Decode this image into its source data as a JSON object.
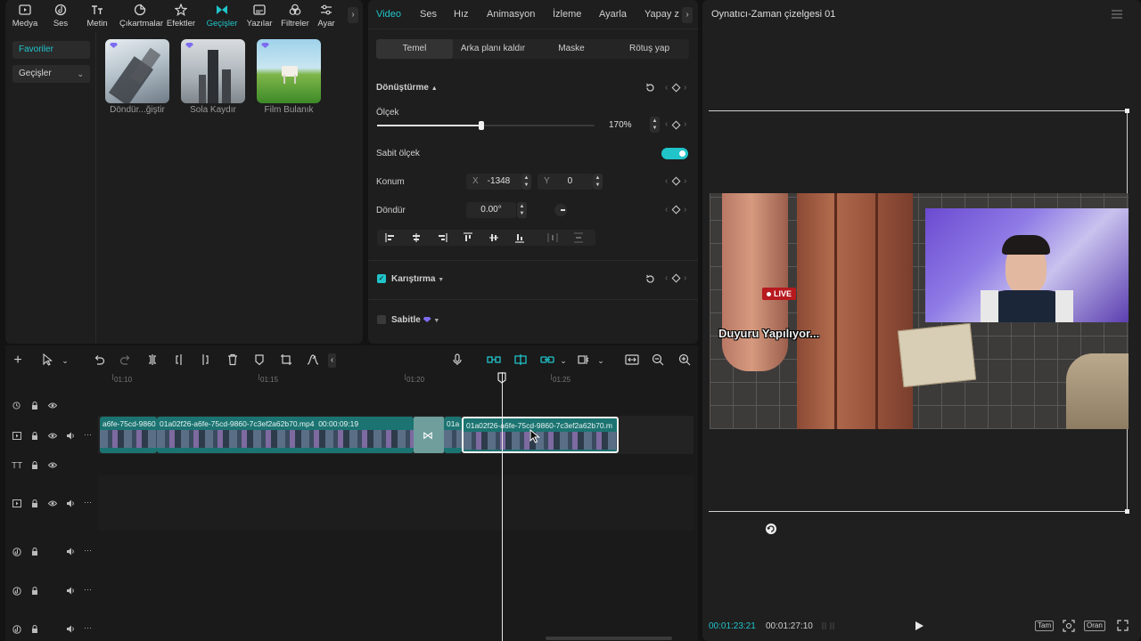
{
  "media_panel": {
    "tabs": [
      {
        "label": "Medya",
        "icon": "media-icon"
      },
      {
        "label": "Ses",
        "icon": "audio-icon"
      },
      {
        "label": "Metin",
        "icon": "text-icon"
      },
      {
        "label": "Çıkartmalar",
        "icon": "sticker-icon"
      },
      {
        "label": "Efektler",
        "icon": "effects-icon"
      },
      {
        "label": "Geçişler",
        "icon": "transitions-icon"
      },
      {
        "label": "Yazılar",
        "icon": "captions-icon"
      },
      {
        "label": "Filtreler",
        "icon": "filters-icon"
      },
      {
        "label": "Ayar",
        "icon": "adjust-icon"
      }
    ],
    "active_tab": "Geçişler",
    "sidebar": {
      "favorites": "Favoriler",
      "transitions": "Geçişler"
    },
    "thumbnails": [
      {
        "label": "Döndür...ğiştir"
      },
      {
        "label": "Sola Kaydır"
      },
      {
        "label": "Film Bulanık"
      }
    ]
  },
  "inspector": {
    "tabs": [
      "Video",
      "Ses",
      "Hız",
      "Animasyon",
      "İzleme",
      "Ayarla",
      "Yapay z"
    ],
    "active_tab": "Video",
    "subtabs": [
      "Temel",
      "Arka planı kaldır",
      "Maske",
      "Rötuş yap"
    ],
    "active_subtab": "Temel",
    "transform": {
      "section_title": "Dönüştürme",
      "scale_label": "Ölçek",
      "scale_value": "170%",
      "scale_slider_fraction": 0.48,
      "uniform_scale_label": "Sabit ölçek",
      "uniform_scale_on": true,
      "position_label": "Konum",
      "x_label": "X",
      "x_value": "-1348",
      "y_label": "Y",
      "y_value": "0",
      "rotate_label": "Döndür",
      "rotate_value": "0.00°"
    },
    "blend": {
      "label": "Karıştırma",
      "checked": true
    },
    "stabilize": {
      "label": "Sabitle",
      "checked": false
    }
  },
  "timeline": {
    "ruler_ticks": [
      "01:10",
      "01:15",
      "01:20",
      "01:25"
    ],
    "clips": [
      {
        "name": "a6fe-75cd-9860",
        "role": "clip-a"
      },
      {
        "name": "01a02f26-a6fe-75cd-9860-7c3ef2a62b70.mp4",
        "duration": "00:00:09:19",
        "role": "clip-b"
      },
      {
        "name": "01a",
        "role": "clip-c"
      },
      {
        "name": "01a02f26-a6fe-75cd-9860-7c3ef2a62b70.m",
        "role": "clip-selected"
      }
    ]
  },
  "player": {
    "title": "Oynatıcı-Zaman çizelgesi 01",
    "current_time": "00:01:23:21",
    "total_time": "00:01:27:10",
    "overlay_live": "LIVE",
    "overlay_text": "Duyuru Yapılıyor...",
    "btn_full": "Tam",
    "btn_ratio": "Oran"
  },
  "colors": {
    "accent": "#20c4c9",
    "panel": "#1e1e1e",
    "background": "#131313",
    "clip": "#1c7e7c",
    "live": "#b71a1f"
  }
}
